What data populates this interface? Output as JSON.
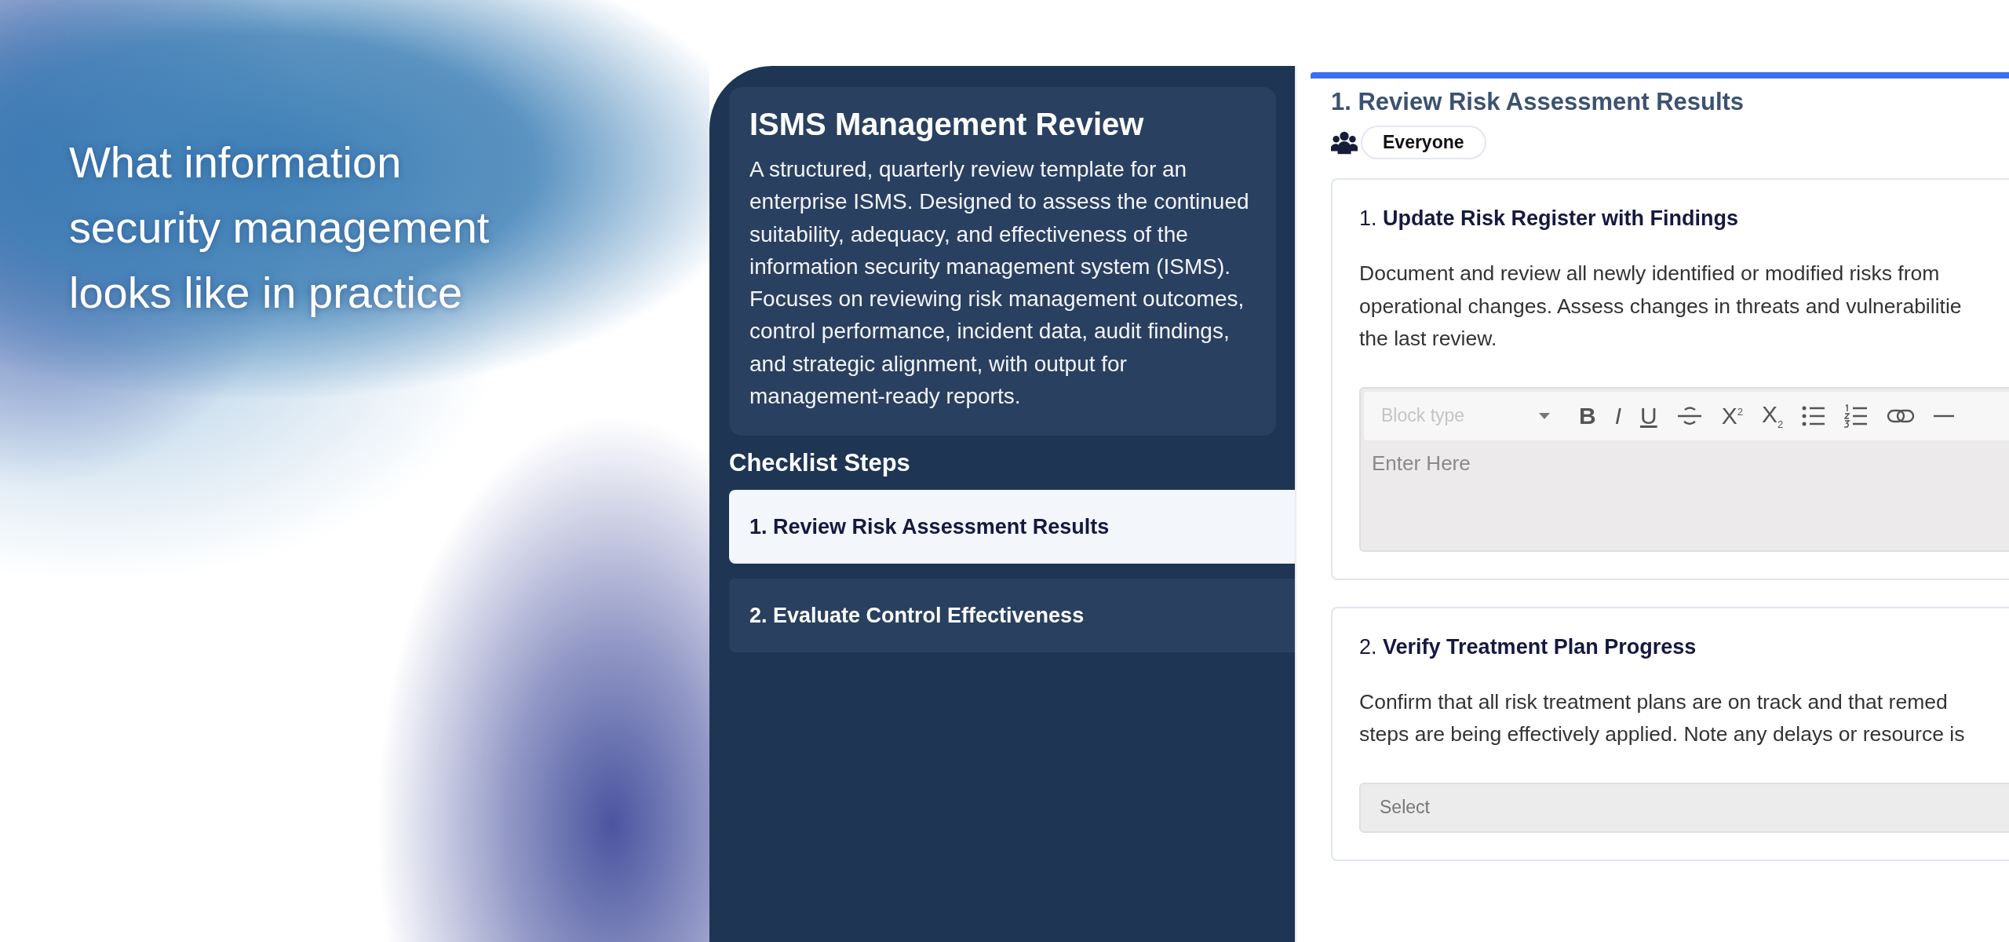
{
  "headline": "What information security management looks like in practice",
  "sidebar": {
    "title": "ISMS Management Review",
    "description": "A structured, quarterly review template for an enterprise ISMS. Designed to assess the continued suitability, adequacy, and effectiveness of the information security management system (ISMS). Focuses on reviewing risk management outcomes, control performance, incident data, audit findings, and strategic alignment, with output for management-ready reports.",
    "steps_heading": "Checklist Steps",
    "steps": [
      {
        "label": "1. Review Risk Assessment Results",
        "selected": true
      },
      {
        "label": "2. Evaluate Control Effectiveness",
        "selected": false
      }
    ]
  },
  "main": {
    "heading": "1. Review Risk Assessment Results",
    "assignee": "Everyone",
    "tasks": [
      {
        "title": "1. **Update Risk Register with Findings**",
        "description_lines": [
          "Document and review all newly identified or modified risks from",
          "operational changes. Assess changes in threats and vulnerabilitie",
          "the last review."
        ],
        "input": {
          "kind": "editor",
          "block_type_placeholder": "Block type",
          "placeholder": "Enter Here",
          "toolbar": [
            "B",
            "I",
            "U",
            "X$^{2}$",
            "X$_{2}$"
          ]
        }
      },
      {
        "title": "2. **Verify Treatment Plan Progress**",
        "description_lines": [
          "Confirm that all risk treatment plans are on track and that remed",
          "steps are being effectively applied. Note any delays or resource is"
        ],
        "input": {
          "kind": "select",
          "placeholder": "Select"
        }
      }
    ]
  }
}
